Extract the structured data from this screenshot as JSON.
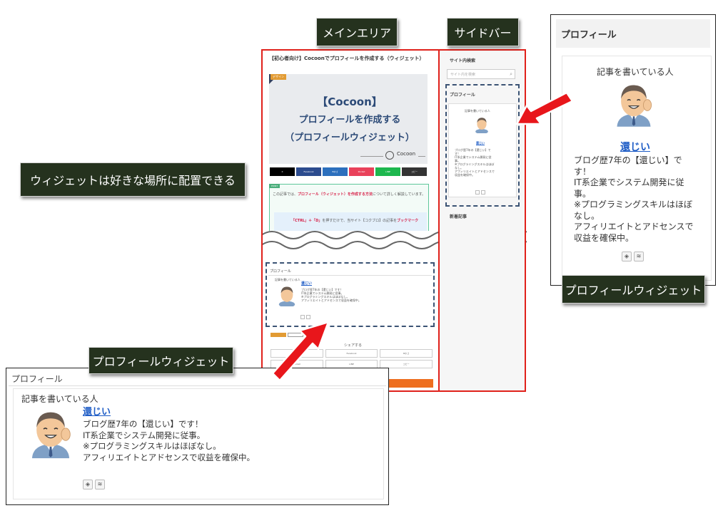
{
  "labels": {
    "main_area": "メインエリア",
    "sidebar": "サイドバー",
    "widget_anywhere": "ウィジェットは好きな場所に配置できる",
    "profile_widget_left": "プロフィールウィジェット",
    "profile_widget_right": "プロフィールウィジェット"
  },
  "article": {
    "title": "【初心者向け】Cocoonでプロフィールを作成する（ウィジェット）",
    "category": "デザイン",
    "eyecatch_line1": "【Cocoon】",
    "eyecatch_line2": "プロフィールを作成する",
    "eyecatch_line3": "（プロフィールウィジェット）",
    "brand": "Cocoon",
    "share_buttons": [
      "X",
      "Facebook",
      "Bホゴ",
      "Pocket",
      "LINE",
      "コピー"
    ],
    "notice_tag": "POINT",
    "notice_text_pre": "この記事では、",
    "notice_highlight": "プロフィール（ウィジェット）を作成する方法",
    "notice_text_post": "について詳しく解説しています。",
    "notice_inner_key": "「CTRL」＋「D」",
    "notice_inner_text": "を押すだけで、当サイト【コクブロ】の記事を",
    "notice_inner_highlight": "ブックマーク",
    "share_heading": "シェアする",
    "share_bottom": [
      "X",
      "Facebook",
      "Bホゴ",
      "Pocket",
      "LINE",
      "コピー"
    ]
  },
  "sidebar": {
    "search_heading": "サイト内検索",
    "search_placeholder": "サイト内を検索",
    "profile_heading": "プロフィール",
    "recent_heading": "新着記事"
  },
  "profile": {
    "heading": "プロフィール",
    "intro": "記事を書いている人",
    "name": "還じい",
    "bio": [
      "ブログ歴7年の【還じい】です！",
      "IT系企業でシステム開発に従事。",
      "※プログラミングスキルはほぼなし。",
      "アフィリエイトとアドセンスで収益を確保中。"
    ],
    "bio_right": [
      "ブログ歴7年の【還じい】で",
      "す！",
      "IT系企業でシステム開発に従",
      "事。",
      "※プログラミングスキルはほぼ",
      "なし。",
      "アフィリエイトとアドセンスで",
      "収益を確保中。"
    ]
  },
  "colors": {
    "chip_bg": "#25321e",
    "frame_red": "#e0211b",
    "dashed_navy": "#3b5374",
    "link_blue": "#1f5dc6",
    "arrow_red": "#e8161b"
  }
}
